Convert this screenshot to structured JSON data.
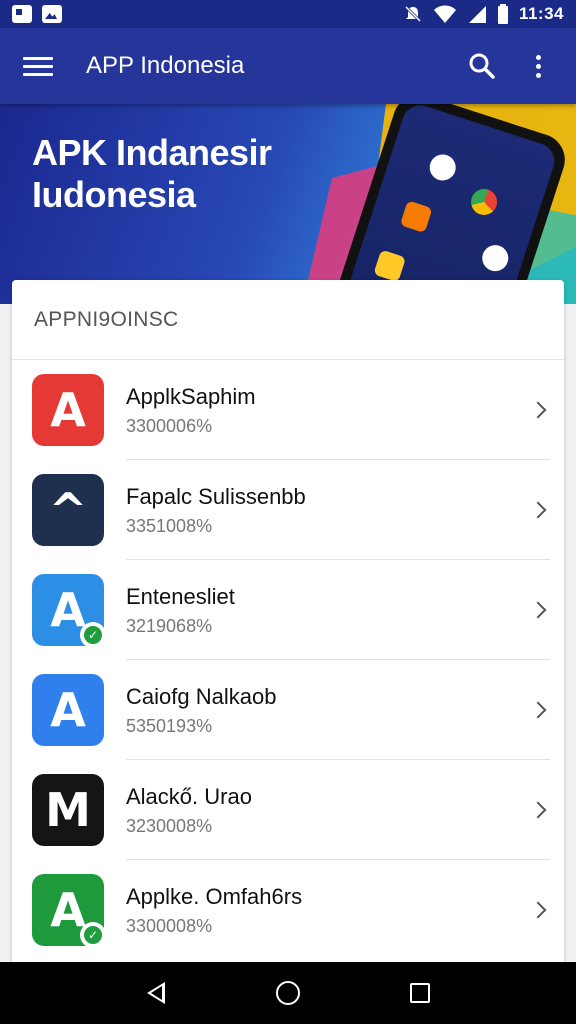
{
  "status_bar": {
    "time": "11:34",
    "icons": [
      "notification-icon",
      "image-icon",
      "silent-icon",
      "wifi-icon",
      "signal-icon",
      "battery-icon"
    ]
  },
  "app_bar": {
    "title": "APP Indonesia",
    "icons": [
      "menu-icon",
      "search-icon",
      "more-icon"
    ]
  },
  "banner": {
    "line1": "APK Indanesir",
    "line2": "Iudonesia",
    "colors": {
      "primary": "#25359a",
      "accent_yellow": "#f2b705",
      "accent_pink": "#e63b7a",
      "accent_teal": "#2fbfb0"
    }
  },
  "list": {
    "header": "APPNI9OINSC",
    "items": [
      {
        "name": "ApplkSaphim",
        "sub": "3300006%",
        "icon_color": "#e53935",
        "glyph": "A",
        "icon": "app-icon-red-a",
        "badge": false
      },
      {
        "name": "Fapalc Sulissenbb",
        "sub": "3351008%",
        "icon_color": "#1f2f4e",
        "glyph": "^",
        "icon": "app-icon-navy-circle",
        "badge": false
      },
      {
        "name": "Entenesliet",
        "sub": "3219068%",
        "icon_color": "#2d8ee6",
        "glyph": "A",
        "icon": "app-icon-blue-yellow-a",
        "badge": true
      },
      {
        "name": "Caiofg Nalkaob",
        "sub": "5350193%",
        "icon_color": "#2f80ed",
        "glyph": "A",
        "icon": "app-icon-blue-a",
        "badge": false
      },
      {
        "name": "Alackő. Urao",
        "sub": "3230008%",
        "icon_color": "#151515",
        "glyph": "M",
        "icon": "app-icon-black-m",
        "badge": false
      },
      {
        "name": "Applke. Omfah6rs",
        "sub": "3300008%",
        "icon_color": "#1e9a3d",
        "glyph": "A",
        "icon": "app-icon-green-a",
        "badge": true
      }
    ]
  },
  "nav_bar": {
    "icons": [
      "back-icon",
      "home-icon",
      "recents-icon"
    ]
  }
}
